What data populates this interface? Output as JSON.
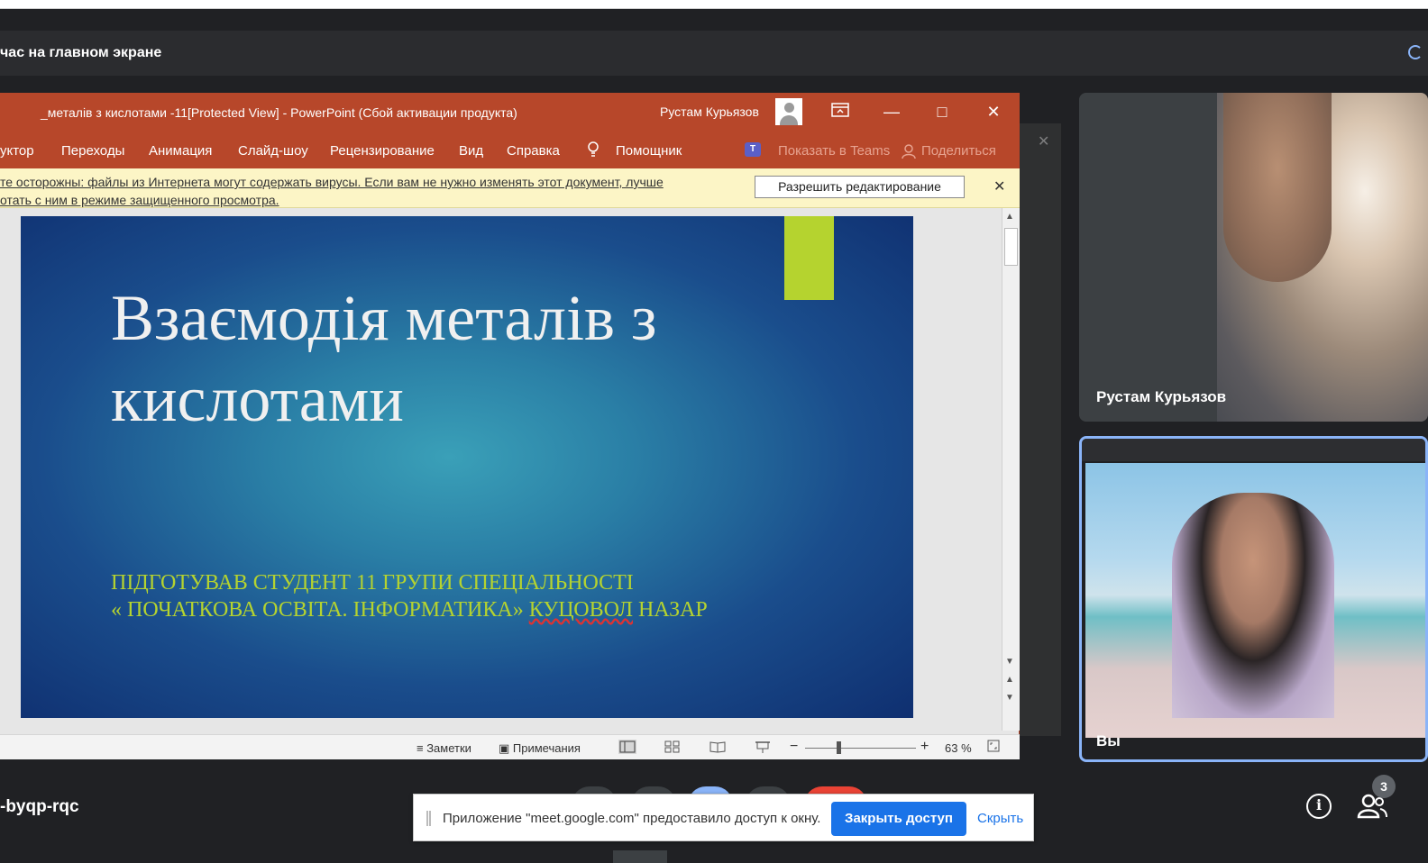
{
  "meet": {
    "header_title": "час на главном экране",
    "meeting_code": "-byqp-rqc",
    "participant_count": "3",
    "accent_color": "#8ab4f8"
  },
  "powerpoint": {
    "window_title": "_металів з кислотами -11[Protected View]  -  PowerPoint (Сбой активации продукта)",
    "user_name": "Рустам Курьязов",
    "title_bar_color": "#b7472a",
    "menu": {
      "items": [
        "уктор",
        "Переходы",
        "Анимация",
        "Слайд-шоу",
        "Рецензирование",
        "Вид",
        "Справка"
      ],
      "tell_me": "Помощник",
      "teams": "Показать в Teams",
      "share": "Поделиться"
    },
    "protected_view": {
      "message_line1": "те осторожны: файлы из Интернета могут содержать вирусы. Если вам не нужно изменять этот документ, лучше",
      "message_line2": "отать с ним в режиме защищенного просмотра.",
      "enable_button": "Разрешить редактирование"
    },
    "slide": {
      "title_line1": "Взаємодія металів з",
      "title_line2": "кислотами",
      "subtitle_line1": "ПІДГОТУВАВ СТУДЕНТ 11 ГРУПИ СПЕЦІАЛЬНОСТІ",
      "subtitle_line2_a": "« ПОЧАТКОВА ОСВІТА. ІНФОРМАТИКА»",
      "subtitle_line2_err": "КУЦОВОЛ",
      "subtitle_line2_b": "НАЗАР"
    },
    "status": {
      "notes": "Заметки",
      "comments": "Примечания",
      "zoom": "63 %"
    }
  },
  "tiles": {
    "participant1": "Рустам Курьязов",
    "self": "Вы"
  },
  "share_notice": {
    "text": "Приложение \"meet.google.com\" предоставило доступ к окну.",
    "stop_button": "Закрыть доступ",
    "hide_button": "Скрыть"
  }
}
